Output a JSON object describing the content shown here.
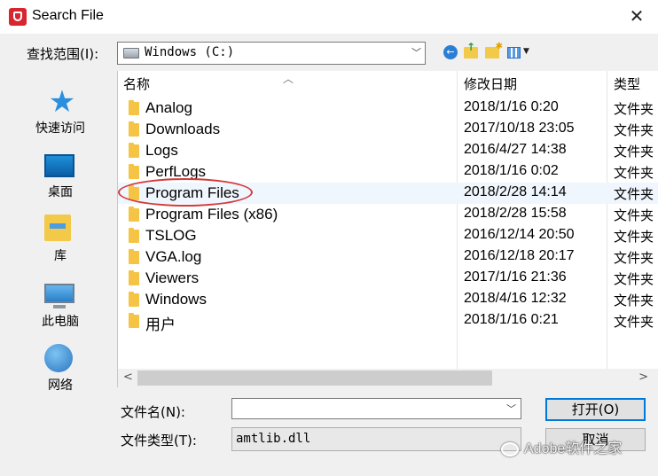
{
  "window": {
    "title": "Search File",
    "close_glyph": "✕"
  },
  "toolbar": {
    "look_in_label": "查找范围(I):",
    "look_in_value": "Windows (C:)",
    "back_glyph": "←"
  },
  "places": [
    {
      "label": "快速访问",
      "icon": "star-icon"
    },
    {
      "label": "桌面",
      "icon": "desktop-icon"
    },
    {
      "label": "库",
      "icon": "library-icon"
    },
    {
      "label": "此电脑",
      "icon": "computer-icon"
    },
    {
      "label": "网络",
      "icon": "network-icon"
    }
  ],
  "columns": {
    "name": "名称",
    "date": "修改日期",
    "type": "类型"
  },
  "files": [
    {
      "name": "Analog",
      "date": "2018/1/16 0:20",
      "type": "文件夹"
    },
    {
      "name": "Downloads",
      "date": "2017/10/18 23:05",
      "type": "文件夹"
    },
    {
      "name": "Logs",
      "date": "2016/4/27 14:38",
      "type": "文件夹"
    },
    {
      "name": "PerfLogs",
      "date": "2018/1/16 0:02",
      "type": "文件夹"
    },
    {
      "name": "Program Files",
      "date": "2018/2/28 14:14",
      "type": "文件夹"
    },
    {
      "name": "Program Files (x86)",
      "date": "2018/2/28 15:58",
      "type": "文件夹"
    },
    {
      "name": "TSLOG",
      "date": "2016/12/14 20:50",
      "type": "文件夹"
    },
    {
      "name": "VGA.log",
      "date": "2016/12/18 20:17",
      "type": "文件夹"
    },
    {
      "name": "Viewers",
      "date": "2017/1/16 21:36",
      "type": "文件夹"
    },
    {
      "name": "Windows",
      "date": "2018/4/16 12:32",
      "type": "文件夹"
    },
    {
      "name": "用户",
      "date": "2018/1/16 0:21",
      "type": "文件夹"
    }
  ],
  "footer": {
    "file_name_label": "文件名(N):",
    "file_name_value": "",
    "file_type_label": "文件类型(T):",
    "file_type_value": "amtlib.dll",
    "open_label": "打开(O)",
    "cancel_label": "取消"
  },
  "watermark": "Adobe软件之家",
  "colors": {
    "accent": "#0078d7",
    "folder": "#f5c444",
    "highlight_oval": "#d43a3a"
  }
}
